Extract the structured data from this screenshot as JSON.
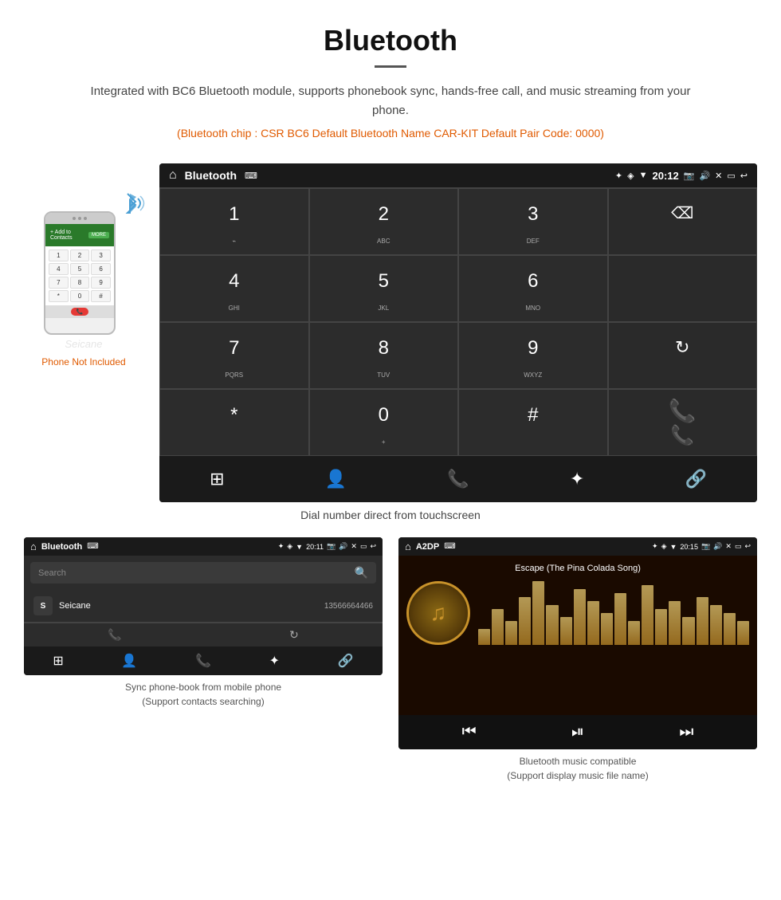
{
  "header": {
    "title": "Bluetooth",
    "description": "Integrated with BC6 Bluetooth module, supports phonebook sync, hands-free call, and music streaming from your phone.",
    "specs": "(Bluetooth chip : CSR BC6    Default Bluetooth Name CAR-KIT    Default Pair Code: 0000)"
  },
  "phone_sidebar": {
    "not_included_label": "Phone Not Included"
  },
  "car_screen": {
    "statusbar": {
      "home_icon": "⌂",
      "title": "Bluetooth",
      "usb_icon": "⌨",
      "time": "20:12",
      "icons": "✦ ◈ ▼ 📷 🔊 ✕ ▭ ↩"
    },
    "dialpad": {
      "keys": [
        {
          "num": "1",
          "sub": "⌁"
        },
        {
          "num": "2",
          "sub": "ABC"
        },
        {
          "num": "3",
          "sub": "DEF"
        },
        {
          "num": "",
          "sub": "",
          "action": "backspace"
        },
        {
          "num": "4",
          "sub": "GHI"
        },
        {
          "num": "5",
          "sub": "JKL"
        },
        {
          "num": "6",
          "sub": "MNO"
        },
        {
          "num": "",
          "sub": "",
          "action": "empty"
        },
        {
          "num": "7",
          "sub": "PQRS"
        },
        {
          "num": "8",
          "sub": "TUV"
        },
        {
          "num": "9",
          "sub": "WXYZ"
        },
        {
          "num": "",
          "sub": "",
          "action": "refresh"
        },
        {
          "num": "*",
          "sub": ""
        },
        {
          "num": "0",
          "sub": "+"
        },
        {
          "num": "#",
          "sub": ""
        },
        {
          "num": "",
          "sub": "",
          "action": "call-end"
        }
      ],
      "call_green_key": {
        "num": "",
        "action": "call-green"
      },
      "call_red_key": {
        "num": "",
        "action": "call-red"
      }
    },
    "toolbar_icons": [
      "⊞",
      "👤",
      "📞",
      "✦",
      "🔗"
    ]
  },
  "main_caption": "Dial number direct from touchscreen",
  "phonebook_screen": {
    "statusbar_title": "Bluetooth",
    "statusbar_time": "20:11",
    "search_placeholder": "Search",
    "entry": {
      "letter": "S",
      "name": "Seicane",
      "number": "13566664466"
    },
    "toolbar_icons": [
      "⊞",
      "👤",
      "📞",
      "✦",
      "🔗"
    ]
  },
  "phonebook_caption": {
    "line1": "Sync phone-book from mobile phone",
    "line2": "(Support contacts searching)"
  },
  "music_screen": {
    "statusbar_title": "A2DP",
    "statusbar_time": "20:15",
    "song_title": "Escape (The Pina Colada Song)",
    "eq_bars": [
      20,
      45,
      30,
      60,
      80,
      50,
      35,
      70,
      55,
      40,
      65,
      30,
      75,
      45,
      55,
      35,
      60,
      50,
      40,
      30
    ],
    "controls": [
      "⏮",
      "⏯",
      "⏭"
    ]
  },
  "music_caption": {
    "line1": "Bluetooth music compatible",
    "line2": "(Support display music file name)"
  }
}
